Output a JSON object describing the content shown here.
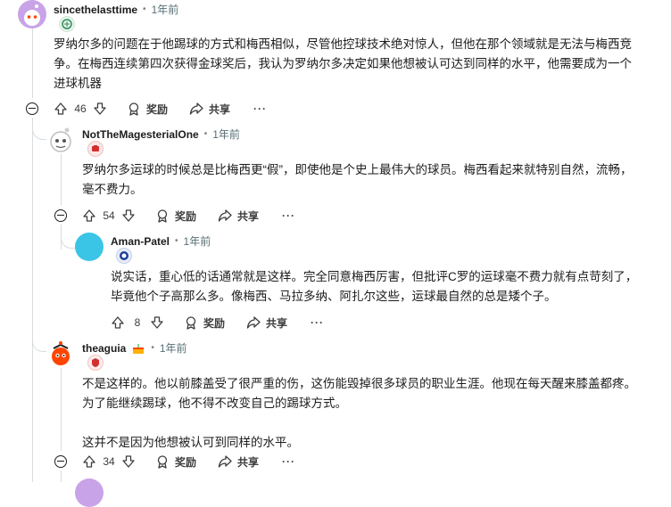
{
  "comments": [
    {
      "username": "sincethelasttime",
      "time": "1年前",
      "paragraphs": [
        "罗纳尔多的问题在于他踢球的方式和梅西相似，尽管他控球技术绝对惊人，但他在那个领域就是无法与梅西竞争。在梅西连续第四次获得金球奖后，我认为罗纳尔多决定如果他想被认可达到同样的水平，他需要成为一个进球机器"
      ],
      "score": "46",
      "award_label": "奖励",
      "share_label": "共享",
      "more_label": "···"
    },
    {
      "username": "NotTheMagesterialOne",
      "time": "1年前",
      "paragraphs": [
        "罗纳尔多运球的时候总是比梅西更“假”，即使他是个史上最伟大的球员。梅西看起来就特别自然，流畅，毫不费力。"
      ],
      "score": "54",
      "award_label": "奖励",
      "share_label": "共享",
      "more_label": "···"
    },
    {
      "username": "Aman-Patel",
      "time": "1年前",
      "paragraphs": [
        "说实话，重心低的话通常就是这样。完全同意梅西厉害，但批评C罗的运球毫不费力就有点苛刻了，毕竟他个子高那么多。像梅西、马拉多纳、阿扎尔这些，运球最自然的总是矮个子。"
      ],
      "score": "8",
      "award_label": "奖励",
      "share_label": "共享",
      "more_label": "···"
    },
    {
      "username": "theaguia",
      "time": "1年前",
      "paragraphs": [
        "不是这样的。他以前膝盖受了很严重的伤，这伤能毁掉很多球员的职业生涯。他现在每天醒来膝盖都疼。为了能继续踢球，他不得不改变自己的踢球方式。",
        "这并不是因为他想被认可到同样的水平。"
      ],
      "score": "34",
      "award_label": "奖励",
      "share_label": "共享",
      "more_label": "···"
    }
  ],
  "colors": {
    "text": "#1c1c1c",
    "meta": "#576f76",
    "thread_line": "#d9dcdf",
    "avatar_blue": "#3ac5e6",
    "avatar_purple": "#c9a3e8"
  },
  "icons": [
    "upvote-icon",
    "downvote-icon",
    "award-icon",
    "share-icon",
    "collapse-icon",
    "more-icon"
  ]
}
